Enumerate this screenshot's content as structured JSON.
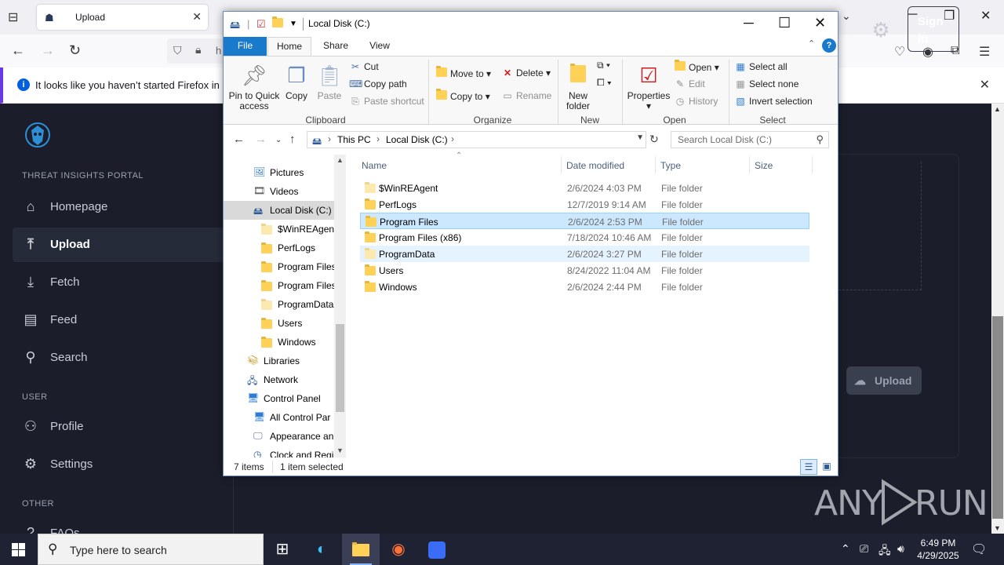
{
  "firefox": {
    "tab_title": "Upload",
    "url_fragment": "h",
    "notice": "It looks like you haven’t started Firefox in a wl"
  },
  "portal": {
    "section_main": "THREAT INSIGHTS PORTAL",
    "nav": [
      {
        "label": "Homepage",
        "icon": "home-icon"
      },
      {
        "label": "Upload",
        "icon": "upload-icon"
      },
      {
        "label": "Fetch",
        "icon": "fetch-icon"
      },
      {
        "label": "Feed",
        "icon": "feed-icon"
      },
      {
        "label": "Search",
        "icon": "search-icon"
      }
    ],
    "section_user": "USER",
    "user_nav": [
      {
        "label": "Profile",
        "icon": "profile-icon"
      },
      {
        "label": "Settings",
        "icon": "settings-icon"
      }
    ],
    "section_other": "OTHER",
    "other_nav": [
      {
        "label": "FAQs",
        "icon": "faq-icon"
      }
    ],
    "signin_label": "Sign in",
    "upload_button": "Upload"
  },
  "explorer": {
    "title": "Local Disk (C:)",
    "menu": {
      "file": "File",
      "home": "Home",
      "share": "Share",
      "view": "View"
    },
    "ribbon": {
      "pin": "Pin to Quick access",
      "copy": "Copy",
      "paste": "Paste",
      "cut": "Cut",
      "copy_path": "Copy path",
      "paste_shortcut": "Paste shortcut",
      "clipboard": "Clipboard",
      "move_to": "Move to",
      "copy_to": "Copy to",
      "delete": "Delete",
      "rename": "Rename",
      "organize": "Organize",
      "new_folder": "New folder",
      "new": "New",
      "properties": "Properties",
      "open": "Open",
      "edit": "Edit",
      "history": "History",
      "open_group": "Open",
      "select_all": "Select all",
      "select_none": "Select none",
      "invert_selection": "Invert selection",
      "select_group": "Select"
    },
    "address": {
      "crumbs": [
        "This PC",
        "Local Disk (C:)"
      ],
      "search_placeholder": "Search Local Disk (C:)"
    },
    "nav_tree": [
      {
        "label": "Pictures",
        "indent": 1,
        "icon": "pictures-icon"
      },
      {
        "label": "Videos",
        "indent": 1,
        "icon": "videos-icon"
      },
      {
        "label": "Local Disk (C:)",
        "indent": 1,
        "icon": "drive-icon",
        "selected": true
      },
      {
        "label": "$WinREAgent",
        "indent": 2,
        "icon": "folder-icon",
        "pale": true
      },
      {
        "label": "PerfLogs",
        "indent": 2,
        "icon": "folder-icon"
      },
      {
        "label": "Program Files",
        "indent": 2,
        "icon": "folder-icon"
      },
      {
        "label": "Program Files",
        "indent": 2,
        "icon": "folder-icon"
      },
      {
        "label": "ProgramData",
        "indent": 2,
        "icon": "folder-icon",
        "pale": true
      },
      {
        "label": "Users",
        "indent": 2,
        "icon": "folder-icon"
      },
      {
        "label": "Windows",
        "indent": 2,
        "icon": "folder-icon"
      },
      {
        "label": "Libraries",
        "indent": 0,
        "icon": "libraries-icon"
      },
      {
        "label": "Network",
        "indent": 0,
        "icon": "network-icon"
      },
      {
        "label": "Control Panel",
        "indent": 0,
        "icon": "control-panel-icon"
      },
      {
        "label": "All Control Par",
        "indent": 1,
        "icon": "control-panel-icon"
      },
      {
        "label": "Appearance an",
        "indent": 1,
        "icon": "appearance-icon"
      },
      {
        "label": "Clock and Regi",
        "indent": 1,
        "icon": "clock-icon"
      }
    ],
    "columns": [
      "Name",
      "Date modified",
      "Type",
      "Size"
    ],
    "files": [
      {
        "name": "$WinREAgent",
        "date": "2/6/2024 4:03 PM",
        "type": "File folder",
        "pale": true
      },
      {
        "name": "PerfLogs",
        "date": "12/7/2019 9:14 AM",
        "type": "File folder"
      },
      {
        "name": "Program Files",
        "date": "2/6/2024 2:53 PM",
        "type": "File folder",
        "selected": true
      },
      {
        "name": "Program Files (x86)",
        "date": "7/18/2024 10:46 AM",
        "type": "File folder"
      },
      {
        "name": "ProgramData",
        "date": "2/6/2024 3:27 PM",
        "type": "File folder",
        "pale": true,
        "hover": true
      },
      {
        "name": "Users",
        "date": "8/24/2022 11:04 AM",
        "type": "File folder"
      },
      {
        "name": "Windows",
        "date": "2/6/2024 2:44 PM",
        "type": "File folder"
      }
    ],
    "status": {
      "count": "7 items",
      "selection": "1 item selected"
    }
  },
  "taskbar": {
    "search_placeholder": "Type here to search",
    "time": "6:49 PM",
    "date": "4/29/2025"
  },
  "watermark": {
    "left": "ANY",
    "right": "RUN"
  }
}
